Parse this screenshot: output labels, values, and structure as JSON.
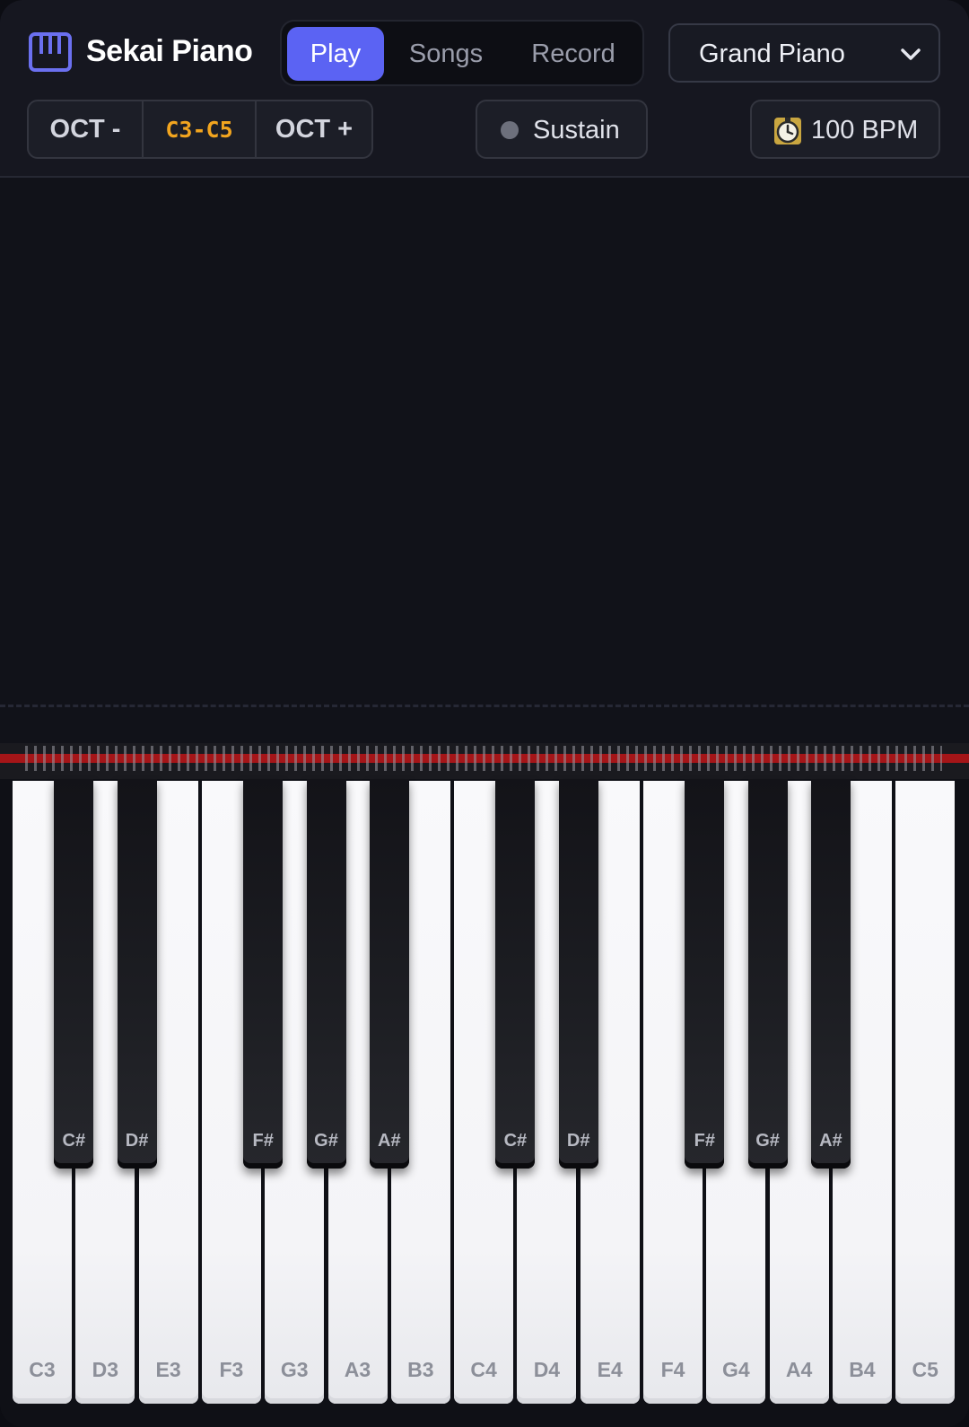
{
  "app": {
    "title": "Sekai Piano"
  },
  "tabs": [
    {
      "label": "Play",
      "active": true
    },
    {
      "label": "Songs",
      "active": false
    },
    {
      "label": "Record",
      "active": false
    }
  ],
  "instrument": {
    "selected": "Grand Piano",
    "icon": "chevron-down-icon"
  },
  "octave": {
    "down_label": "OCT -",
    "range": "C3-C5",
    "up_label": "OCT +"
  },
  "sustain": {
    "label": "Sustain",
    "on": false
  },
  "tempo": {
    "label": "100 BPM",
    "icon": "stopwatch-icon"
  },
  "colors": {
    "accent": "#5b63f3",
    "range_highlight": "#f2a51f",
    "felt": "#a51518",
    "background": "#111219"
  },
  "keyboard": {
    "white_keys": [
      "C3",
      "D3",
      "E3",
      "F3",
      "G3",
      "A3",
      "B3",
      "C4",
      "D4",
      "E4",
      "F4",
      "G4",
      "A4",
      "B4",
      "C5"
    ],
    "black_keys": [
      "C#",
      "D#",
      "F#",
      "G#",
      "A#",
      "C#",
      "D#",
      "F#",
      "G#",
      "A#"
    ]
  }
}
